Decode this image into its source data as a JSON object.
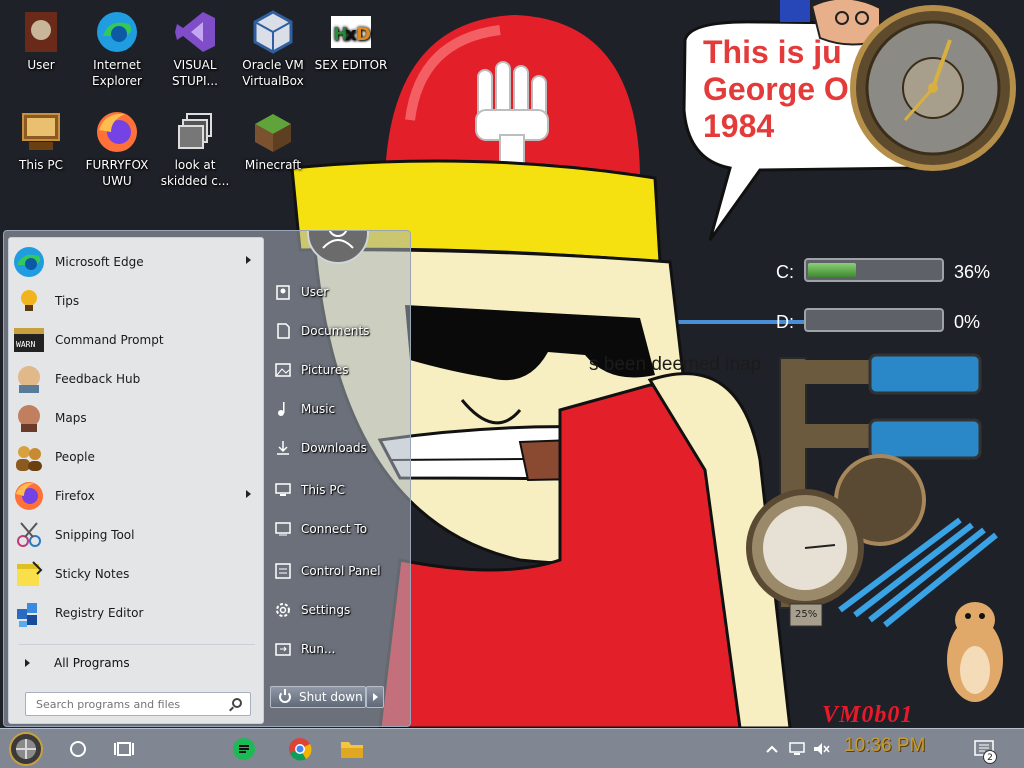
{
  "desktop": {
    "icons": [
      {
        "label": "User"
      },
      {
        "label": "Internet Explorer"
      },
      {
        "label": "VISUAL STUPI..."
      },
      {
        "label": "Oracle VM VirtualBox"
      },
      {
        "label": "SEX EDITOR"
      },
      {
        "label": "This PC"
      },
      {
        "label": "FURRYFOX UWU"
      },
      {
        "label": "look at skidded c..."
      },
      {
        "label": "Minecraft"
      }
    ],
    "wallpaper": {
      "speech_text": "This is ju\nGeorge O\n1984",
      "partial_text": "s been deemed inap"
    },
    "watermark": "VM0b01"
  },
  "gadgets": {
    "drives": [
      {
        "label": "C:",
        "percent": "36%",
        "fill": 0.36
      },
      {
        "label": "D:",
        "percent": "0%",
        "fill": 0.0
      }
    ],
    "gauge_text": "25%"
  },
  "start_menu": {
    "programs": [
      {
        "label": "Microsoft Edge",
        "icon": "edge-icon",
        "has_submenu": true
      },
      {
        "label": "Tips",
        "icon": "tips-icon"
      },
      {
        "label": "Command Prompt",
        "icon": "command-prompt-icon"
      },
      {
        "label": "Feedback Hub",
        "icon": "feedback-hub-icon"
      },
      {
        "label": "Maps",
        "icon": "maps-icon"
      },
      {
        "label": "People",
        "icon": "people-icon"
      },
      {
        "label": "Firefox",
        "icon": "firefox-icon",
        "has_submenu": true
      },
      {
        "label": "Snipping Tool",
        "icon": "snipping-tool-icon"
      },
      {
        "label": "Sticky Notes",
        "icon": "sticky-notes-icon"
      },
      {
        "label": "Registry Editor",
        "icon": "registry-editor-icon"
      }
    ],
    "all_programs": "All Programs",
    "search_placeholder": "Search programs and files",
    "right_items": [
      {
        "label": "User",
        "icon": "user-folder-icon"
      },
      {
        "label": "Documents",
        "icon": "documents-icon"
      },
      {
        "label": "Pictures",
        "icon": "pictures-icon"
      },
      {
        "label": "Music",
        "icon": "music-icon"
      },
      {
        "label": "Downloads",
        "icon": "downloads-icon"
      },
      {
        "label": "This PC",
        "icon": "this-pc-icon"
      },
      {
        "label": "Connect To",
        "icon": "connect-to-icon"
      },
      {
        "label": "Control Panel",
        "icon": "control-panel-icon"
      },
      {
        "label": "Settings",
        "icon": "settings-icon"
      },
      {
        "label": "Run...",
        "icon": "run-icon"
      }
    ],
    "shutdown_label": "Shut down"
  },
  "taskbar": {
    "clock": "10:36 PM",
    "notification_count": "2"
  },
  "colors": {
    "wallpaper_bg": "#1f2128",
    "speech_red": "#e33a3a",
    "watermark_red": "#e81a2a",
    "clock_gold": "#c99a2e"
  }
}
